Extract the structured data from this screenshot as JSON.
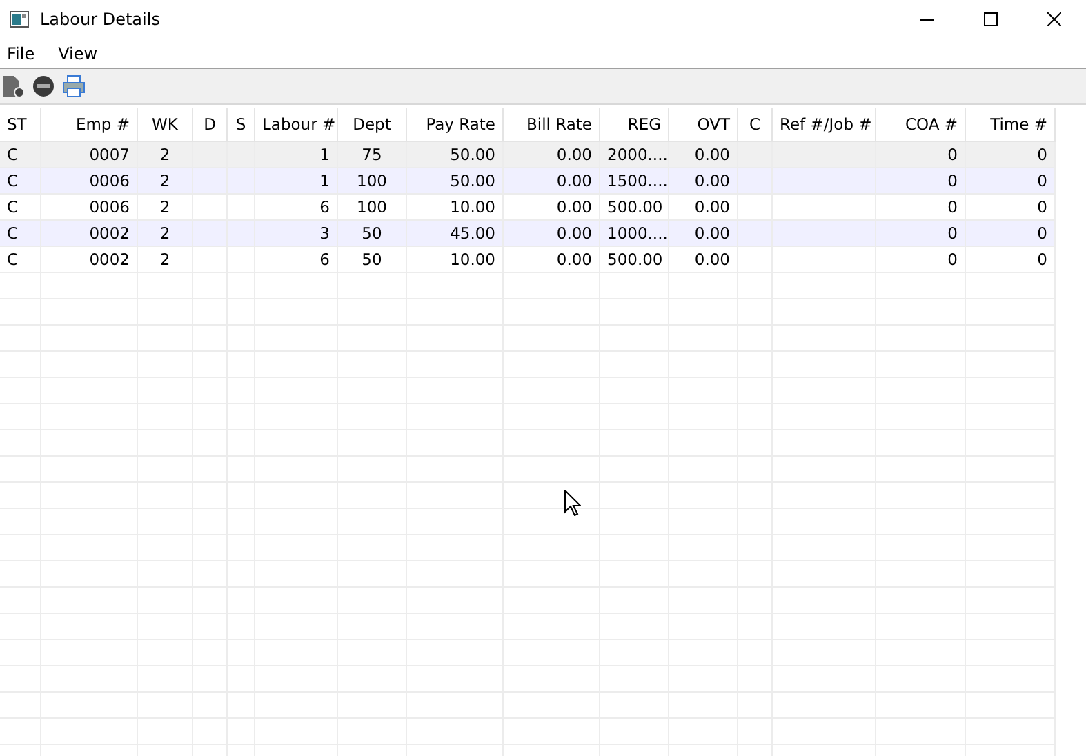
{
  "window": {
    "title": "Labour Details"
  },
  "menu": [
    "File",
    "View"
  ],
  "table": {
    "columns": [
      "ST",
      "Emp #",
      "WK",
      "D",
      "S",
      "Labour #",
      "Dept",
      "Pay Rate",
      "Bill Rate",
      "REG",
      "OVT",
      "C",
      "Ref #/Job #",
      "COA #",
      "Time #"
    ],
    "rows": [
      {
        "selected": true,
        "cells": [
          "C",
          "0007",
          "2",
          "",
          "",
          "1",
          "75",
          "50.00",
          "0.00",
          "2000....",
          "0.00",
          "",
          "",
          "0",
          "0"
        ]
      },
      {
        "selected": false,
        "cells": [
          "C",
          "0006",
          "2",
          "",
          "",
          "1",
          "100",
          "50.00",
          "0.00",
          "1500....",
          "0.00",
          "",
          "",
          "0",
          "0"
        ]
      },
      {
        "selected": false,
        "cells": [
          "C",
          "0006",
          "2",
          "",
          "",
          "6",
          "100",
          "10.00",
          "0.00",
          "500.00",
          "0.00",
          "",
          "",
          "0",
          "0"
        ]
      },
      {
        "selected": false,
        "cells": [
          "C",
          "0002",
          "2",
          "",
          "",
          "3",
          "50",
          "45.00",
          "0.00",
          "1000....",
          "0.00",
          "",
          "",
          "0",
          "0"
        ]
      },
      {
        "selected": false,
        "cells": [
          "C",
          "0002",
          "2",
          "",
          "",
          "6",
          "50",
          "10.00",
          "0.00",
          "500.00",
          "0.00",
          "",
          "",
          "0",
          "0"
        ]
      }
    ]
  }
}
